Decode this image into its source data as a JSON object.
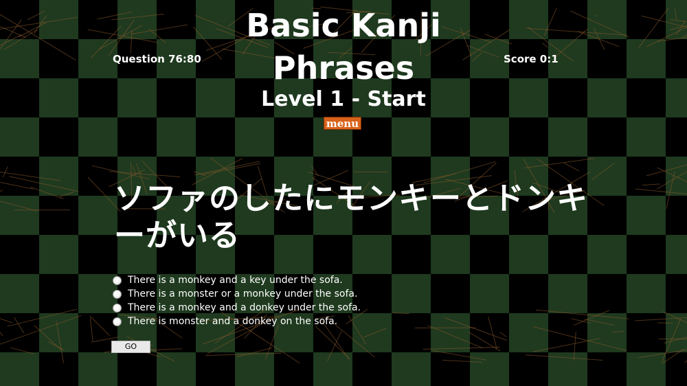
{
  "header": {
    "title_line1": "Basic Kanji",
    "title_line2": "Phrases",
    "subtitle": "Level 1 - Start",
    "menu_label": "menu"
  },
  "status": {
    "question_counter": "Question 76:80",
    "score": "Score 0:1"
  },
  "question": {
    "text": "ソファのしたにモンキーとドンキーがいる",
    "answers": [
      "There is a monkey and a key under the sofa.",
      "There is a monster or a monkey under the sofa.",
      "There is a monkey and a donkey under the sofa.",
      "There is monster and a donkey on the sofa."
    ],
    "go_label": "GO"
  },
  "colors": {
    "background_dark": "#000000",
    "checker_green": "#1f3a1f",
    "scribble": "#8a5a2b",
    "menu_button": "#d8621a"
  }
}
